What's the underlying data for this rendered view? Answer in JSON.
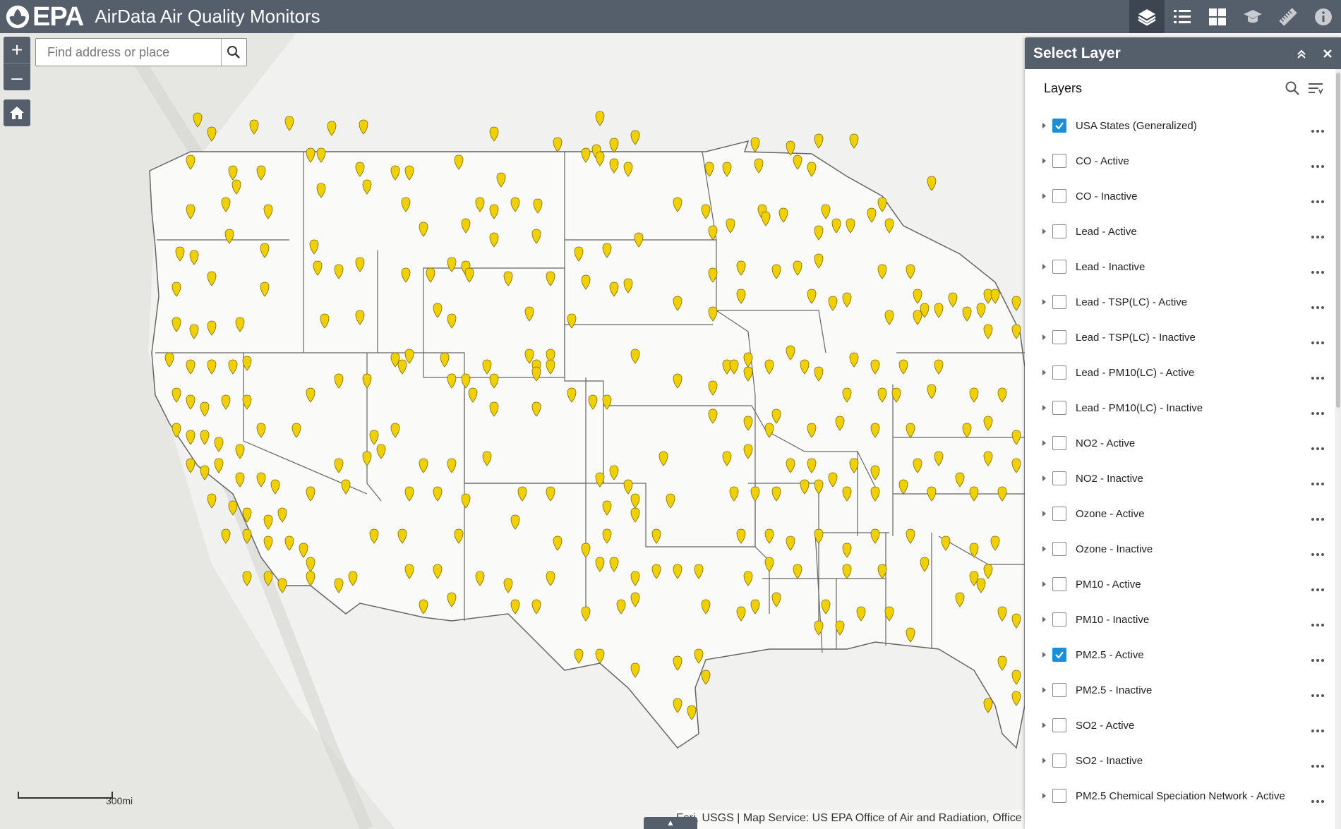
{
  "header": {
    "logo_text": "EPA",
    "app_title": "AirData Air Quality Monitors",
    "tools": [
      "layers-icon",
      "legend-icon",
      "basemap-gallery-icon",
      "about-icon",
      "measurement-icon",
      "info-icon"
    ]
  },
  "map": {
    "search_placeholder": "Find address or place",
    "zoom_in": "+",
    "zoom_out": "–",
    "scale_label": "300mi",
    "attribution": "Esri, USGS | Map Service: US EPA Office of Air and Radiation, Office",
    "collapse_arrow": "▲",
    "marker_color": "#f0d000"
  },
  "panel": {
    "title": "Select Layer",
    "layers_heading": "Layers",
    "layers": [
      {
        "label": "USA States (Generalized)",
        "checked": true
      },
      {
        "label": "CO - Active",
        "checked": false
      },
      {
        "label": "CO - Inactive",
        "checked": false
      },
      {
        "label": "Lead - Active",
        "checked": false
      },
      {
        "label": "Lead - Inactive",
        "checked": false
      },
      {
        "label": "Lead - TSP(LC) - Active",
        "checked": false
      },
      {
        "label": "Lead - TSP(LC) - Inactive",
        "checked": false
      },
      {
        "label": "Lead - PM10(LC) - Active",
        "checked": false
      },
      {
        "label": "Lead - PM10(LC) - Inactive",
        "checked": false
      },
      {
        "label": "NO2 - Active",
        "checked": false
      },
      {
        "label": "NO2 - Inactive",
        "checked": false
      },
      {
        "label": "Ozone - Active",
        "checked": false
      },
      {
        "label": "Ozone - Inactive",
        "checked": false
      },
      {
        "label": "PM10 - Active",
        "checked": false
      },
      {
        "label": "PM10 - Inactive",
        "checked": false
      },
      {
        "label": "PM2.5 - Active",
        "checked": true
      },
      {
        "label": "PM2.5 - Inactive",
        "checked": false
      },
      {
        "label": "SO2 - Active",
        "checked": false
      },
      {
        "label": "SO2 - Inactive",
        "checked": false
      },
      {
        "label": "PM2.5 Chemical Speciation Network - Active",
        "checked": false
      }
    ]
  }
}
